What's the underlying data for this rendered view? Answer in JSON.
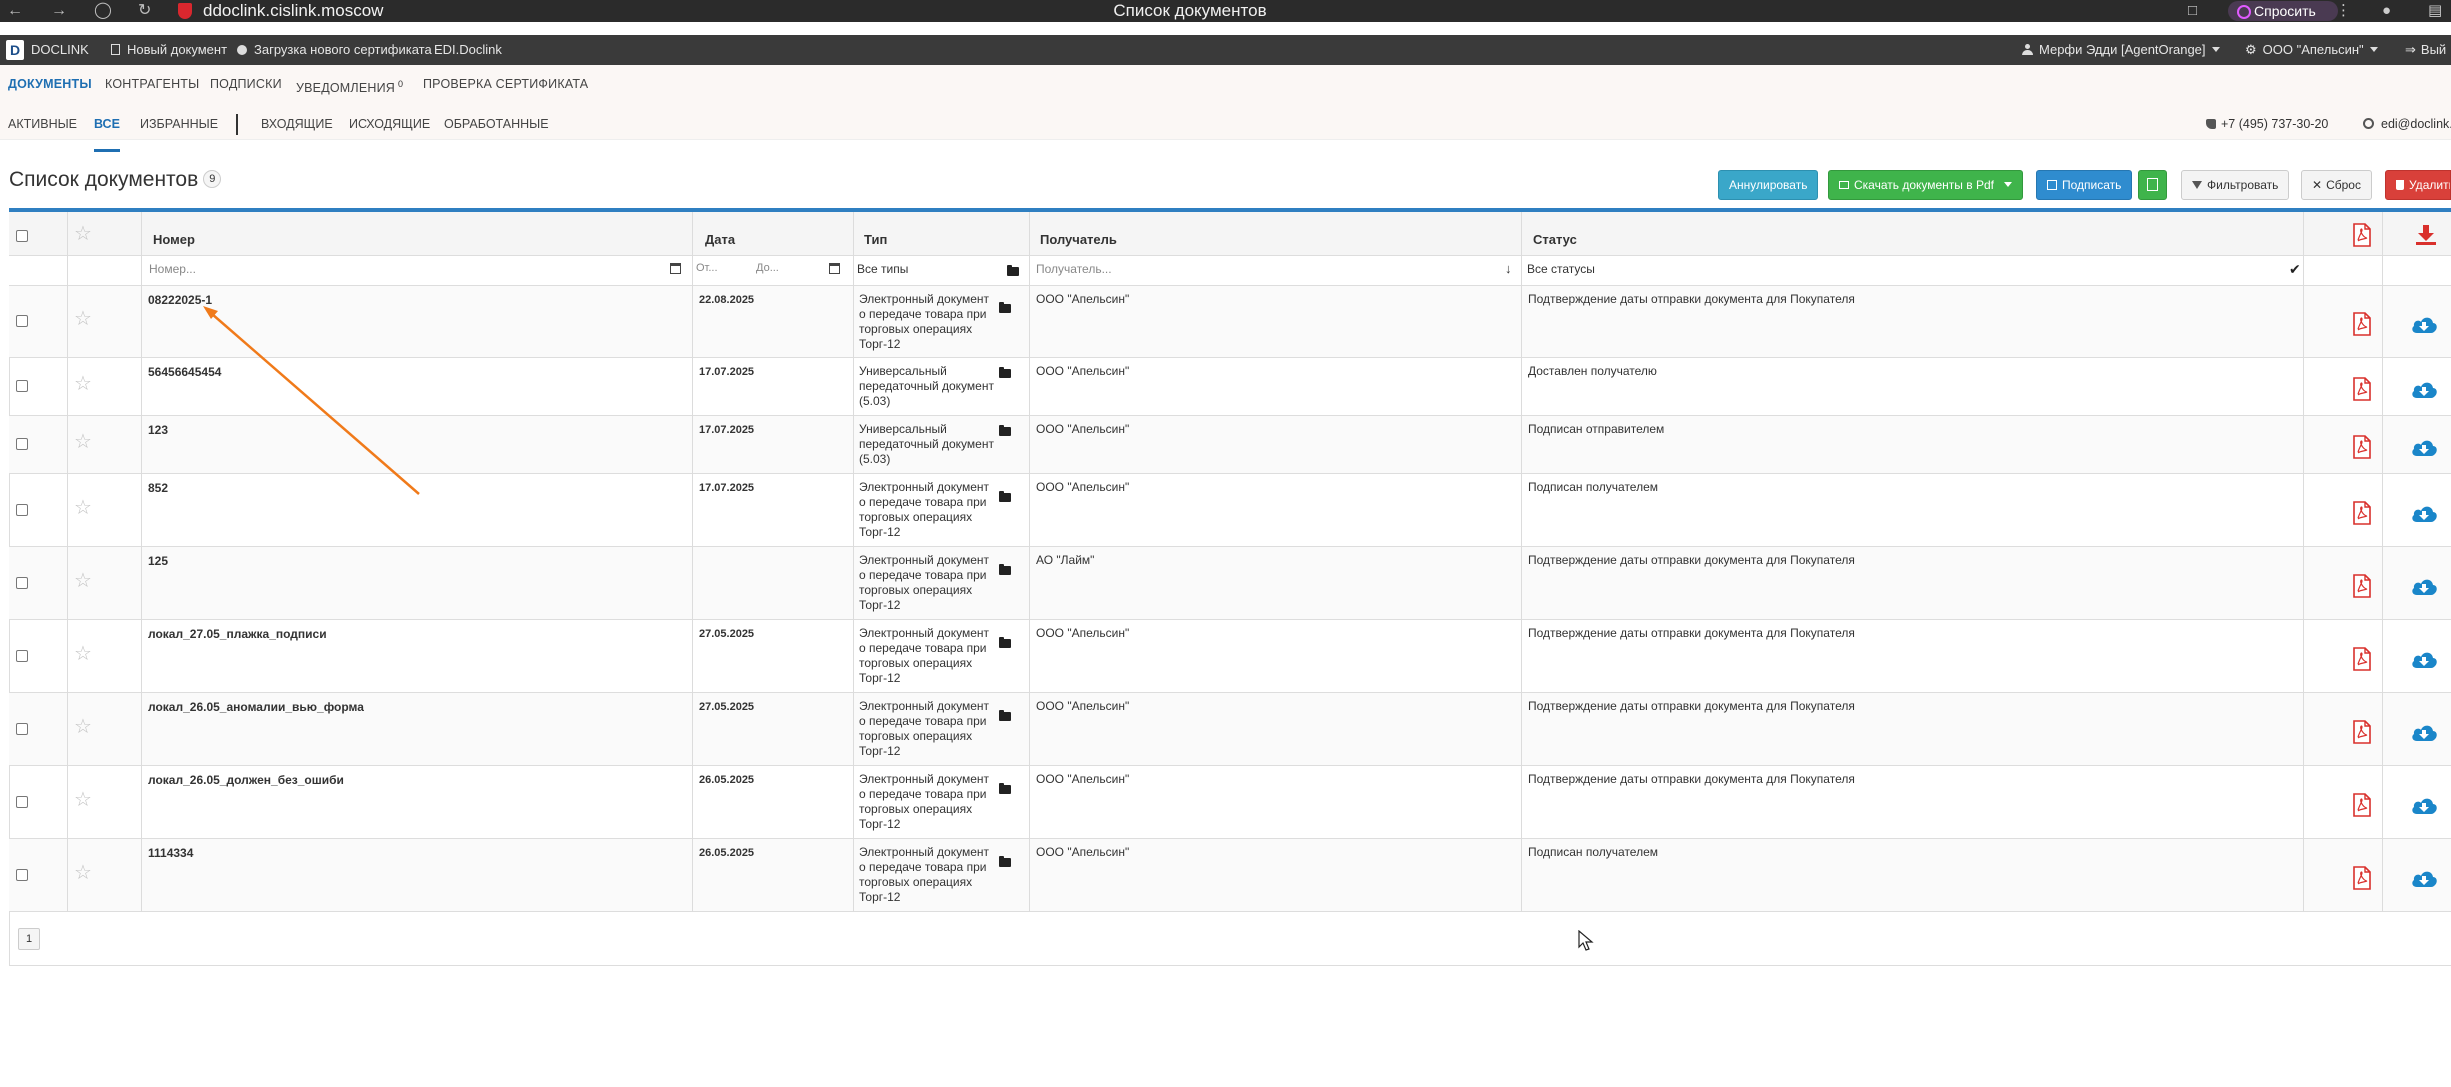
{
  "browser": {
    "url": "ddoclink.cislink.moscow",
    "window_title": "Список документов",
    "ask_label": "Спросить"
  },
  "header": {
    "brand": "DOCLINK",
    "new_document": "Новый документ",
    "upload_certificate": "Загрузка нового сертификата",
    "edi_link": "EDI.Doclink",
    "user": "Мерфи Эдди [AgentOrange]",
    "organization": "ООО \"Апельсин\"",
    "logout": "Вый"
  },
  "main_nav": {
    "tabs": [
      {
        "label": "ДОКУМЕНТЫ"
      },
      {
        "label": "КОНТРАГЕНТЫ"
      },
      {
        "label": "ПОДПИСКИ"
      },
      {
        "label": "УВЕДОМЛЕНИЯ",
        "badge": "0"
      },
      {
        "label": "ПРОВЕРКА СЕРТИФИКАТА"
      }
    ]
  },
  "sub_nav": {
    "tabs": [
      {
        "label": "АКТИВНЫЕ"
      },
      {
        "label": "ВСЕ"
      },
      {
        "label": "ИЗБРАННЫЕ"
      },
      {
        "label": "ВХОДЯЩИЕ"
      },
      {
        "label": "ИСХОДЯЩИЕ"
      },
      {
        "label": "ОБРАБОТАННЫЕ"
      }
    ],
    "phone": "+7 (495) 737-30-20",
    "email": "edi@doclink."
  },
  "page": {
    "title": "Список документов",
    "count": "9"
  },
  "toolbar": {
    "annul": "Аннулировать",
    "download_pdf": "Скачать документы в Pdf",
    "sign": "Подписать",
    "filter": "Фильтровать",
    "reset": "Сброс",
    "delete": "Удалить"
  },
  "table": {
    "headers": {
      "number": "Номер",
      "date": "Дата",
      "type": "Тип",
      "recipient": "Получатель",
      "status": "Статус"
    },
    "filters": {
      "number_placeholder": "Номер...",
      "date_from": "От...",
      "date_to": "До...",
      "type_value": "Все типы",
      "recipient_placeholder": "Получатель...",
      "status_value": "Все статусы"
    },
    "rows": [
      {
        "number": "08222025-1",
        "date": "22.08.2025",
        "type": "Электронный документ о передаче товара при торговых операциях Торг-12",
        "recipient": "ООО \"Апельсин\"",
        "status": "Подтверждение даты отправки документа для Покупателя"
      },
      {
        "number": "56456645454",
        "date": "17.07.2025",
        "type": "Универсальный передаточный документ (5.03)",
        "recipient": "ООО \"Апельсин\"",
        "status": "Доставлен получателю"
      },
      {
        "number": "123",
        "date": "17.07.2025",
        "type": "Универсальный передаточный документ (5.03)",
        "recipient": "ООО \"Апельсин\"",
        "status": "Подписан отправителем"
      },
      {
        "number": "852",
        "date": "17.07.2025",
        "type": "Электронный документ о передаче товара при торговых операциях Торг-12",
        "recipient": "ООО \"Апельсин\"",
        "status": "Подписан получателем"
      },
      {
        "number": "125",
        "date": "",
        "type": "Электронный документ о передаче товара при торговых операциях Торг-12",
        "recipient": "АО \"Лайм\"",
        "status": "Подтверждение даты отправки документа для Покупателя"
      },
      {
        "number": "локал_27.05_плажка_подписи",
        "date": "27.05.2025",
        "type": "Электронный документ о передаче товара при торговых операциях Торг-12",
        "recipient": "ООО \"Апельсин\"",
        "status": "Подтверждение даты отправки документа для Покупателя"
      },
      {
        "number": "локал_26.05_аномалии_вью_форма",
        "date": "27.05.2025",
        "type": "Электронный документ о передаче товара при торговых операциях Торг-12",
        "recipient": "ООО \"Апельсин\"",
        "status": "Подтверждение даты отправки документа для Покупателя"
      },
      {
        "number": "локал_26.05_должен_без_ошиби",
        "date": "26.05.2025",
        "type": "Электронный документ о передаче товара при торговых операциях Торг-12",
        "recipient": "ООО \"Апельсин\"",
        "status": "Подтверждение даты отправки документа для Покупателя"
      },
      {
        "number": "1114334",
        "date": "26.05.2025",
        "type": "Электронный документ о передаче товара при торговых операциях Торг-12",
        "recipient": "ООО \"Апельсин\"",
        "status": "Подписан получателем"
      }
    ]
  },
  "pagination": {
    "current": "1"
  },
  "colors": {
    "accent": "#1f6fb2",
    "annotation_arrow": "#f07a1a",
    "pdf_red": "#d9302c",
    "cloud_blue": "#1a86c9"
  }
}
